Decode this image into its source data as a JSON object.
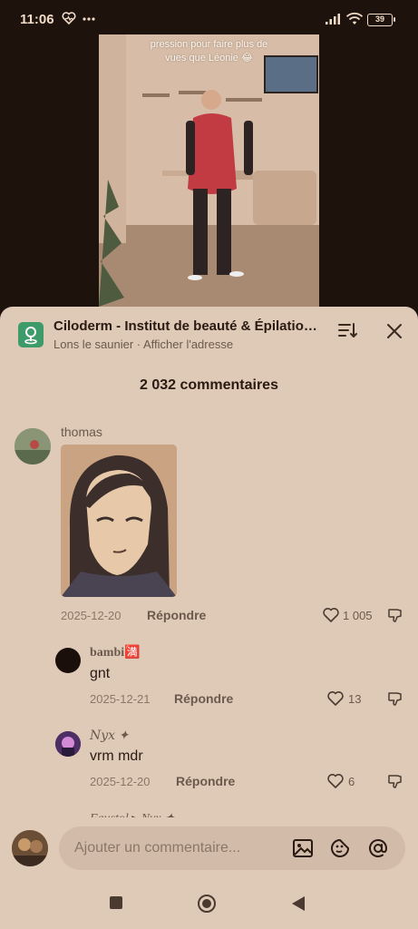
{
  "status_bar": {
    "time": "11:06",
    "battery": "39"
  },
  "video": {
    "caption_line1": "pression pour faire plus de",
    "caption_line2": "vues que Léonie 😂"
  },
  "store": {
    "name": "Ciloderm - Institut de beauté & Épilation laser",
    "location": "Lons le saunier · Afficher l'adresse"
  },
  "comments_header": {
    "title": "2 032 commentaires"
  },
  "comments": [
    {
      "author": "thomas",
      "text": "",
      "date": "2025-12-20",
      "reply_label": "Répondre",
      "likes": "1 005",
      "has_sticker": true
    },
    {
      "author": "bambi🈵",
      "text": "gnt",
      "date": "2025-12-21",
      "reply_label": "Répondre",
      "likes": "13"
    },
    {
      "author": "𝑁𝑦𝑥 ✦",
      "text": "vrm mdr",
      "date": "2025-12-20",
      "reply_label": "Répondre",
      "likes": "6"
    }
  ],
  "partial_author": "Faustol ▸ Nyx ✦",
  "composer": {
    "placeholder": "Ajouter un commentaire..."
  },
  "colors": {
    "sheet": "#dfc9b7",
    "background": "#1e120c",
    "store_badge": "#3d9b6a",
    "text": "#2a1a12",
    "muted": "#6d5a4c"
  }
}
